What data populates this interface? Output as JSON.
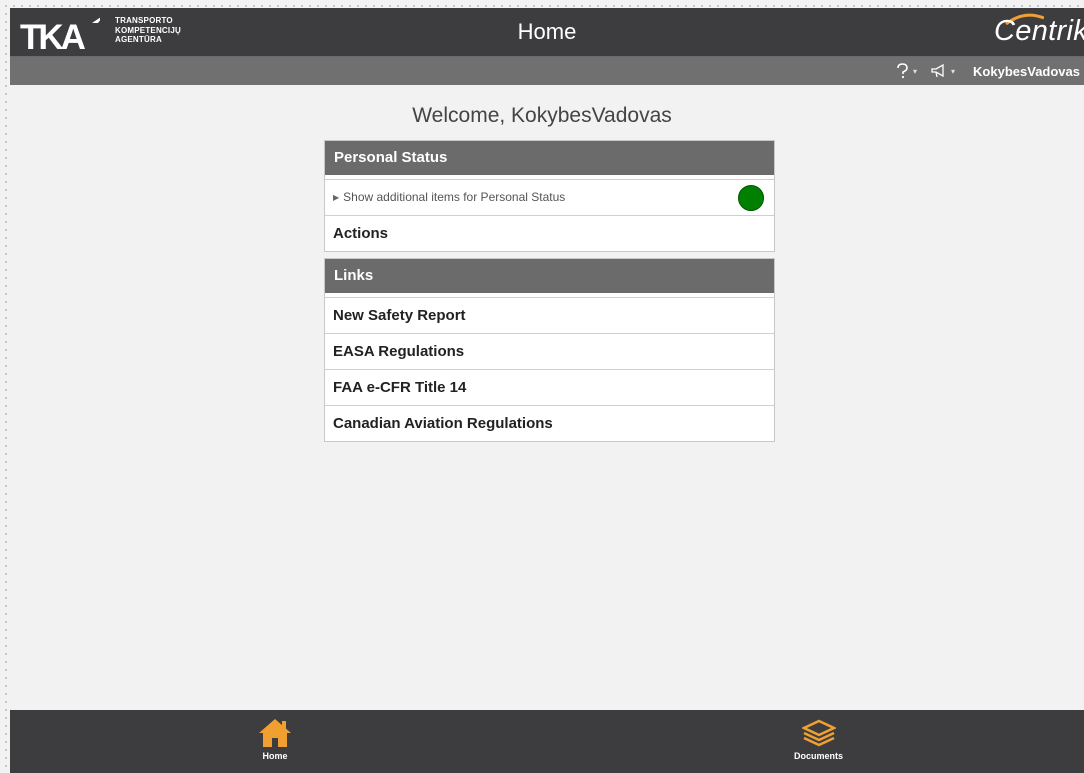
{
  "header": {
    "logo_letters": "TKA",
    "logo_lines": [
      "TRANSPORTO",
      "KOMPETENCIJŲ",
      "AGENTŪRA"
    ],
    "title": "Home",
    "brand": "Centrik",
    "bg_color": "#3d3d40"
  },
  "subbar": {
    "help_icon": "help-icon",
    "announce_icon": "megaphone-icon",
    "username": "KokybesVadovas"
  },
  "main": {
    "welcome": "Welcome, KokybesVadovas",
    "personal_status": {
      "title": "Personal Status",
      "expand_text": "Show additional items for Personal Status",
      "status_color": "#008000",
      "actions_label": "Actions"
    },
    "links": {
      "title": "Links",
      "items": [
        "New Safety Report",
        "EASA Regulations",
        "FAA e-CFR Title 14",
        "Canadian Aviation Regulations"
      ]
    }
  },
  "footer": {
    "items": [
      {
        "label": "Home",
        "icon": "home-icon",
        "color": "#f0a030"
      },
      {
        "label": "Documents",
        "icon": "layers-icon",
        "color": "#f0a030"
      }
    ]
  }
}
